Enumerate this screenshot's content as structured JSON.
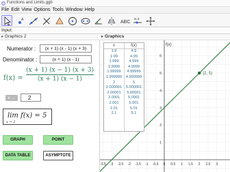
{
  "window": {
    "title": "Functions and Limits.ggb"
  },
  "menu": [
    "File",
    "Edit",
    "View",
    "Options",
    "Tools",
    "Window",
    "Help"
  ],
  "toolbar": {
    "tools": [
      "move-tool",
      "point-tool",
      "line-tool",
      "perpendicular-line-tool",
      "polygon-tool",
      "circle-tool",
      "ellipse-tool",
      "angle-tool",
      "reflect-tool",
      "text-tool",
      "slider-tool",
      "move-graphics-view-tool"
    ],
    "slider_label": "a=2"
  },
  "input_bar": {
    "label": "Input:"
  },
  "graphics2": {
    "header": "Graphics 2",
    "numerator_label": "Numerator :",
    "numerator_value": "(x + 1) (x - 1) (x + 3)",
    "denominator_label": "Denominator :",
    "denominator_value": "(x + 1) (x - 1)",
    "fx_label": "f(x) =",
    "fx_numerator": "(x + 1) (x − 1) (x + 3)",
    "fx_denominator": "(x + 1) (x − 1)",
    "x_arrow_label": "x →",
    "x_arrow_value": "2",
    "limit_text": "lim f(x) = 5",
    "limit_subscript": "x → 2",
    "buttons": {
      "graph": "GRAPH",
      "point": "POINT",
      "data_table": "DATA TABLE",
      "asymptote": "ASYMPTOTE"
    },
    "colors": {
      "formula": "#2f7f5f",
      "button_green": "#9fe39f"
    }
  },
  "graphics1": {
    "header": "Graphics",
    "table": {
      "headers": [
        "x",
        "f(x)"
      ],
      "rows": [
        [
          "1.9",
          "4.9"
        ],
        [
          "1.99",
          "4.99"
        ],
        [
          "1.999",
          "4.999"
        ],
        [
          "1.9999",
          "4.9999"
        ],
        [
          "1.99999",
          "4.99999"
        ],
        [
          "1.999999",
          "4.999999"
        ],
        [
          "2",
          "5"
        ],
        [
          "2.000001",
          "5.000001"
        ],
        [
          "2.00001",
          "5.00001"
        ],
        [
          "2.0001",
          "5.0001"
        ],
        [
          "2.001",
          "5.001"
        ],
        [
          "2.01",
          "5.01"
        ],
        [
          "2.1",
          "5.1"
        ]
      ]
    },
    "y_axis_label": "f(x)",
    "point_label": "(2, 5)",
    "x_ticks": [
      "-3.5",
      "-3",
      "-2.5",
      "-2",
      "-1.5",
      "-1",
      "-0.5",
      "0",
      "0.5",
      "1",
      "1.5",
      "2",
      "2.5",
      "3"
    ],
    "y_ticks": [
      "7",
      "6",
      "5",
      "4",
      "3",
      "2",
      "1",
      "0",
      "-1"
    ],
    "colors": {
      "line": "#2f7f3f",
      "point": "#2f6f3f"
    }
  }
}
